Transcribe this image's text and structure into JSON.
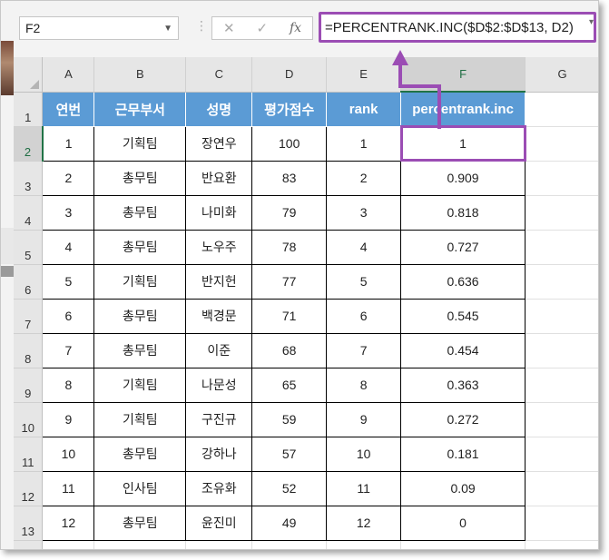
{
  "name_box": {
    "value": "F2"
  },
  "formula_bar": {
    "cancel_icon": "close-icon",
    "enter_icon": "check-icon",
    "function_label": "fx",
    "formula": "=PERCENTRANK.INC($D$2:$D$13, D2)"
  },
  "columns": [
    "A",
    "B",
    "C",
    "D",
    "E",
    "F",
    "G"
  ],
  "rows": [
    "1",
    "2",
    "3",
    "4",
    "5",
    "6",
    "7",
    "8",
    "9",
    "10",
    "11",
    "12",
    "13",
    ""
  ],
  "headers": [
    "연번",
    "근무부서",
    "성명",
    "평가점수",
    "rank",
    "percentrank.inc"
  ],
  "data": [
    [
      "1",
      "기획팀",
      "장연우",
      "100",
      "1",
      "1"
    ],
    [
      "2",
      "총무팀",
      "반요환",
      "83",
      "2",
      "0.909"
    ],
    [
      "3",
      "총무팀",
      "나미화",
      "79",
      "3",
      "0.818"
    ],
    [
      "4",
      "총무팀",
      "노우주",
      "78",
      "4",
      "0.727"
    ],
    [
      "5",
      "기획팀",
      "반지헌",
      "77",
      "5",
      "0.636"
    ],
    [
      "6",
      "총무팀",
      "백경문",
      "71",
      "6",
      "0.545"
    ],
    [
      "7",
      "총무팀",
      "이준",
      "68",
      "7",
      "0.454"
    ],
    [
      "8",
      "기획팀",
      "나문성",
      "65",
      "8",
      "0.363"
    ],
    [
      "9",
      "기획팀",
      "구진규",
      "59",
      "9",
      "0.272"
    ],
    [
      "10",
      "총무팀",
      "강하나",
      "57",
      "10",
      "0.181"
    ],
    [
      "11",
      "인사팀",
      "조유화",
      "52",
      "11",
      "0.09"
    ],
    [
      "12",
      "총무팀",
      "윤진미",
      "49",
      "12",
      "0"
    ]
  ],
  "colors": {
    "header_fill": "#5b9bd5",
    "highlight": "#9b4db4",
    "selection": "#217346"
  }
}
